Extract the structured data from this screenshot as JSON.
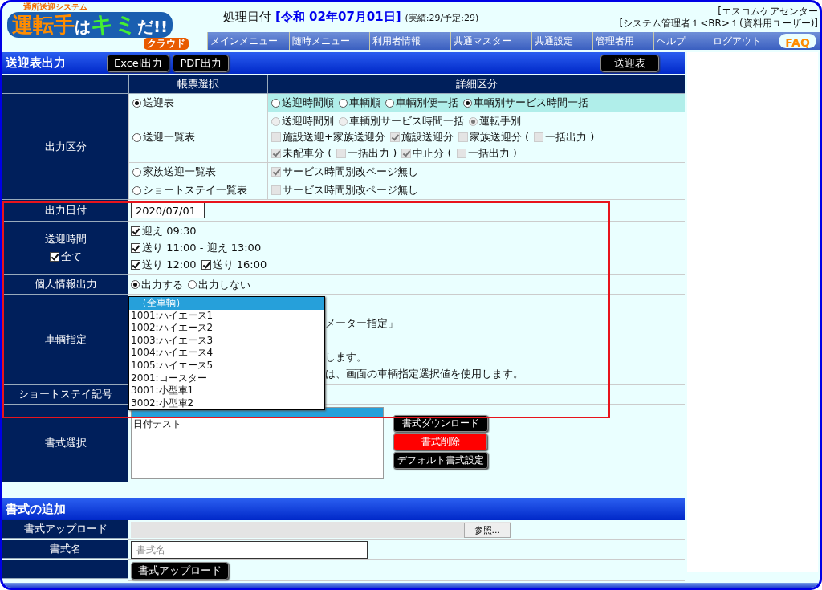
{
  "header": {
    "logo": {
      "tagline": "通所送迎システム",
      "parts": [
        {
          "text": "運転手",
          "kind": "orange"
        },
        {
          "text": "は",
          "kind": "white"
        },
        {
          "text": "キミ",
          "kind": "green"
        },
        {
          "text": "だ!!",
          "kind": "white"
        }
      ],
      "badge": "クラウド"
    },
    "processing": {
      "label": "処理日付",
      "date": "[令和 02年07月01日]",
      "counts": "(実績:29/予定:29)"
    },
    "user_lines": [
      "[エスコムケアセンター",
      "[システム管理者１<BR>１(資料用ユーザー)]"
    ],
    "nav": [
      {
        "label": "メインメニュー"
      },
      {
        "label": "随時メニュー"
      },
      {
        "label": "利用者情報"
      },
      {
        "label": "共通マスター"
      },
      {
        "label": "共通設定"
      },
      {
        "label": "管理者用"
      },
      {
        "label": "ヘルプ"
      },
      {
        "label": "ログアウト"
      }
    ],
    "faq": "FAQ"
  },
  "section": {
    "title": "送迎表出力",
    "buttons": [
      "Excel出力",
      "PDF出力"
    ],
    "right_button": "送迎表"
  },
  "columns": [
    "帳票選択",
    "詳細区分"
  ],
  "output_type": {
    "label": "出力区分",
    "rows": [
      {
        "label": "送迎表",
        "selected": true,
        "lines": [
          [
            {
              "kind": "radio",
              "label": "送迎時間順",
              "checked": false,
              "disabled": false
            },
            {
              "kind": "radio",
              "label": "車輌順",
              "checked": false,
              "disabled": false
            },
            {
              "kind": "radio",
              "label": "車輌別便一括",
              "checked": false,
              "disabled": false
            },
            {
              "kind": "radio",
              "label": "車輌別サービス時間一括",
              "checked": true,
              "disabled": false
            }
          ]
        ]
      },
      {
        "label": "送迎一覧表",
        "selected": false,
        "lines": [
          [
            {
              "kind": "radio",
              "label": "送迎時間別",
              "checked": false,
              "disabled": true
            },
            {
              "kind": "radio",
              "label": "車輌別サービス時間一括",
              "checked": false,
              "disabled": true
            },
            {
              "kind": "radio",
              "label": "運転手別",
              "checked": true,
              "disabled": true
            }
          ],
          [
            {
              "kind": "checkbox",
              "label": "施設送迎+家族送迎分",
              "checked": false,
              "disabled": true
            },
            {
              "kind": "checkbox",
              "label": "施設送迎分",
              "checked": true,
              "disabled": true
            },
            {
              "kind": "checkbox",
              "label": "家族送迎分 (",
              "checked": false,
              "disabled": true
            },
            {
              "kind": "checkbox",
              "label": "一括出力 )",
              "checked": false,
              "disabled": true
            }
          ],
          [
            {
              "kind": "checkbox",
              "label": "未配車分 (",
              "checked": true,
              "disabled": true
            },
            {
              "kind": "checkbox",
              "label": "一括出力 )",
              "checked": false,
              "disabled": true
            },
            {
              "kind": "checkbox",
              "label": "中止分 (",
              "checked": true,
              "disabled": true
            },
            {
              "kind": "checkbox",
              "label": "一括出力 )",
              "checked": false,
              "disabled": true
            }
          ]
        ]
      },
      {
        "label": "家族送迎一覧表",
        "selected": false,
        "lines": [
          [
            {
              "kind": "checkbox",
              "label": "サービス時間別改ページ無し",
              "checked": true,
              "disabled": true
            }
          ]
        ]
      },
      {
        "label": "ショートステイ一覧表",
        "selected": false,
        "lines": [
          [
            {
              "kind": "checkbox",
              "label": "サービス時間別改ページ無し",
              "checked": false,
              "disabled": true
            }
          ]
        ]
      }
    ]
  },
  "output_date": {
    "label": "出力日付",
    "value": "2020/07/01"
  },
  "pickup_time": {
    "label": "送迎時間",
    "all": {
      "label": "全て",
      "checked": true
    },
    "lines": [
      [
        {
          "label": "迎え 09:30",
          "checked": true
        }
      ],
      [
        {
          "label": "送り 11:00 - 迎え 13:00",
          "checked": true
        }
      ],
      [
        {
          "label": "送り 12:00",
          "checked": true
        },
        {
          "label": "送り 16:00",
          "checked": true
        }
      ]
    ]
  },
  "personal_info": {
    "label": "個人情報出力",
    "options": [
      {
        "label": "出力する",
        "selected": true
      },
      {
        "label": "出力しない",
        "selected": false
      }
    ]
  },
  "vehicle": {
    "label": "車輌指定",
    "notes": [
      "メーター指定」",
      "します。",
      "は、画面の車輌指定選択値を使用します。"
    ],
    "options": [
      {
        "label": "（全車輌）",
        "selected": true
      },
      {
        "label": "1001:ハイエース1",
        "selected": false
      },
      {
        "label": "1002:ハイエース2",
        "selected": false
      },
      {
        "label": "1003:ハイエース3",
        "selected": false
      },
      {
        "label": "1004:ハイエース4",
        "selected": false
      },
      {
        "label": "1005:ハイエース5",
        "selected": false
      },
      {
        "label": "2001:コースター",
        "selected": false
      },
      {
        "label": "3001:小型車1",
        "selected": false
      },
      {
        "label": "3002:小型車2",
        "selected": false
      }
    ]
  },
  "short_stay": {
    "label": "ショートステイ記号"
  },
  "format_select": {
    "label": "書式選択",
    "top_item_selected": true,
    "items": [
      "日付テスト"
    ],
    "buttons": [
      {
        "label": "書式ダウンロード",
        "kind": "normal"
      },
      {
        "label": "書式削除",
        "kind": "danger"
      },
      {
        "label": "デフォルト書式設定",
        "kind": "normal"
      }
    ]
  },
  "add_section": {
    "title": "書式の追加",
    "upload_label": "書式アップロード",
    "browse": "参照...",
    "name_label": "書式名",
    "name_placeholder": "書式名",
    "upload_button": "書式アップロード"
  }
}
